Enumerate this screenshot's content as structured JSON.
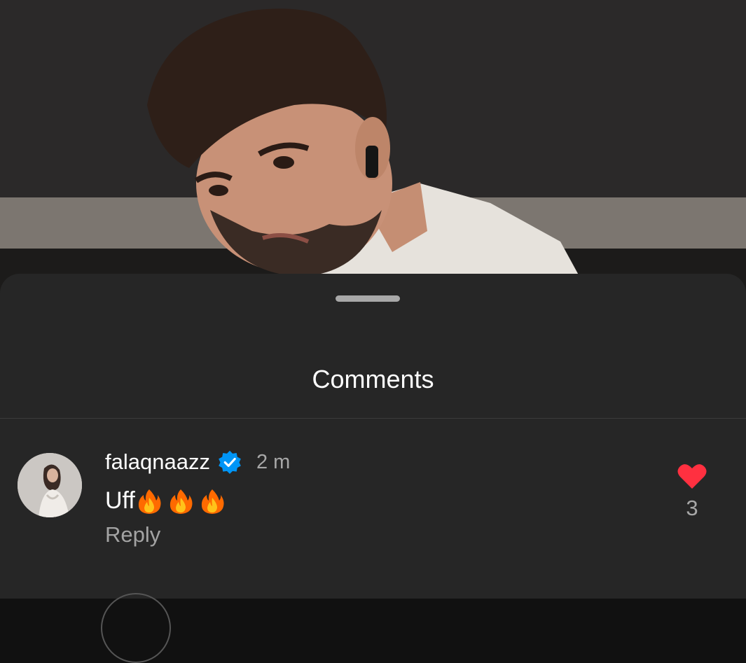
{
  "sheet": {
    "title": "Comments"
  },
  "comment": {
    "username": "falaqnaazz",
    "verified": true,
    "time": "2 m",
    "text": "Uff",
    "emojis": [
      "fire-emoji",
      "fire-emoji",
      "fire-emoji"
    ],
    "reply_label": "Reply",
    "likes": "3",
    "liked": true
  },
  "colors": {
    "sheet_background": "#262626",
    "like_red": "#ff3040",
    "verified_blue": "#0095f6"
  }
}
